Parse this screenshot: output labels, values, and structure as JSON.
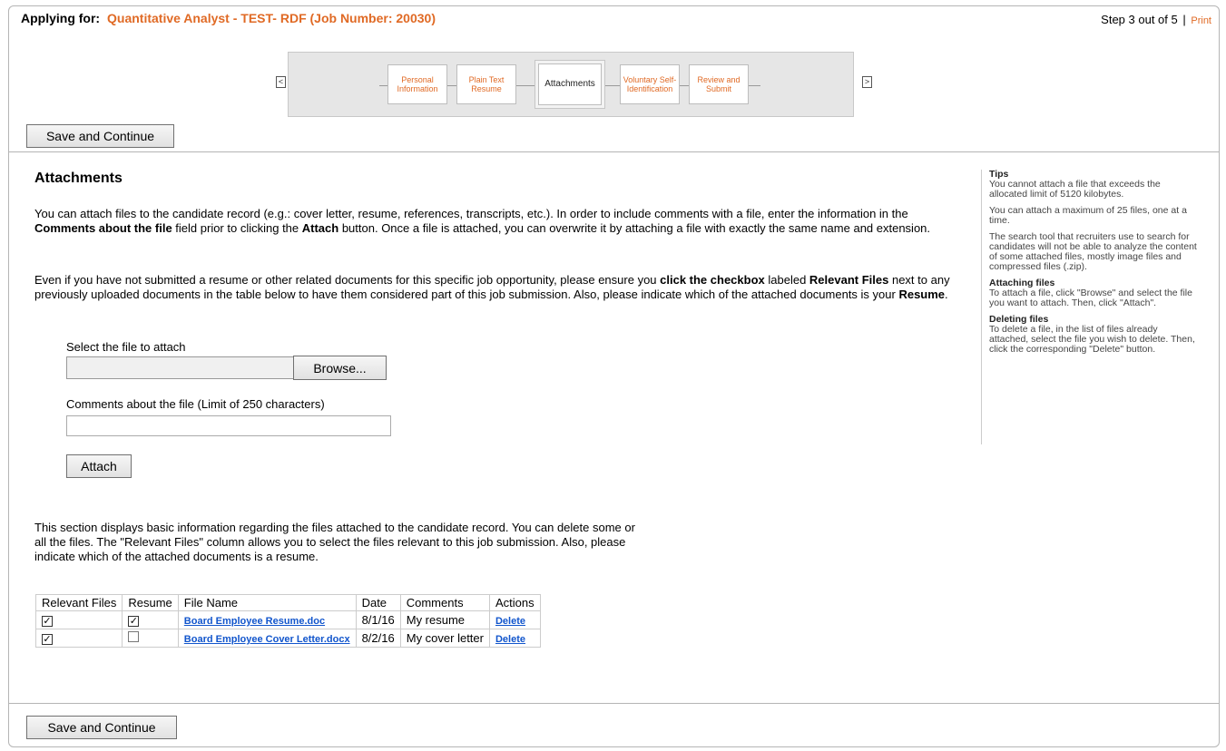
{
  "header": {
    "applying_label": "Applying for:",
    "job_title": "Quantitative Analyst - TEST- RDF (Job Number: 20030)",
    "step_text": "Step 3 out of 5",
    "separator": "|",
    "print_link": "Print"
  },
  "wizard": {
    "steps": [
      {
        "label": "Personal Information"
      },
      {
        "label": "Plain Text Resume"
      },
      {
        "label": "Attachments"
      },
      {
        "label": "Voluntary Self-Identification"
      },
      {
        "label": "Review and Submit"
      }
    ],
    "prev_arrow": "<",
    "next_arrow": ">"
  },
  "save_continue_label": "Save and Continue",
  "attachments": {
    "heading": "Attachments",
    "para1_a": "You can attach files to the candidate record (e.g.: cover letter, resume, references, transcripts, etc.). In order to include comments with a file, enter the information in the ",
    "para1_b": "Comments about the file",
    "para1_c": " field prior to clicking the ",
    "para1_d": "Attach",
    "para1_e": " button. Once a file is attached, you can overwrite it by attaching a file with exactly the same name and extension.",
    "para2_a": "Even if you have not submitted a resume or other related documents for this specific job opportunity, please ensure you ",
    "para2_b": "click the checkbox",
    "para2_c": " labeled ",
    "para2_d": "Relevant Files",
    "para2_e": " next to any previously uploaded documents in the table below to have them considered part of this job submission.  Also, please indicate which of the attached documents is your ",
    "para2_f": "Resume",
    "para2_g": ".",
    "select_label": "Select the file to attach",
    "browse_label": "Browse...",
    "comments_label": "Comments about the file (Limit of 250 characters)",
    "attach_label": "Attach",
    "files_para": "This section displays basic information regarding the files attached to the candidate record. You can delete some or all the files. The \"Relevant Files\" column allows you to select the files relevant to this job submission. Also, please indicate which of the attached documents is a resume."
  },
  "files_table": {
    "headers": [
      "Relevant Files",
      "Resume",
      "File Name",
      "Date",
      "Comments",
      "Actions"
    ],
    "rows": [
      {
        "relevant": true,
        "resume": true,
        "file_name": "Board Employee Resume.doc",
        "date": "8/1/16",
        "comments": "My resume",
        "action": "Delete"
      },
      {
        "relevant": true,
        "resume": false,
        "file_name": "Board Employee Cover Letter.docx",
        "date": "8/2/16",
        "comments": "My cover letter",
        "action": "Delete"
      }
    ]
  },
  "tips": {
    "title": "Tips",
    "tip1": "You cannot attach a file that exceeds the allocated limit of 5120 kilobytes.",
    "tip2": "You can attach a maximum of 25 files, one at a time.",
    "tip3": "The search tool that recruiters use to search for candidates will not be able to analyze the content of some attached files, mostly image files and compressed files (.zip).",
    "attaching_title": "Attaching files",
    "attaching_text": "To attach a file, click \"Browse\" and select the file you want to attach. Then, click \"Attach\".",
    "deleting_title": "Deleting files",
    "deleting_text": "To delete a file, in the list of files already attached, select the file you wish to delete. Then, click the corresponding \"Delete\" button."
  },
  "colors": {
    "accent": "#e06a25",
    "link": "#1155cc"
  }
}
